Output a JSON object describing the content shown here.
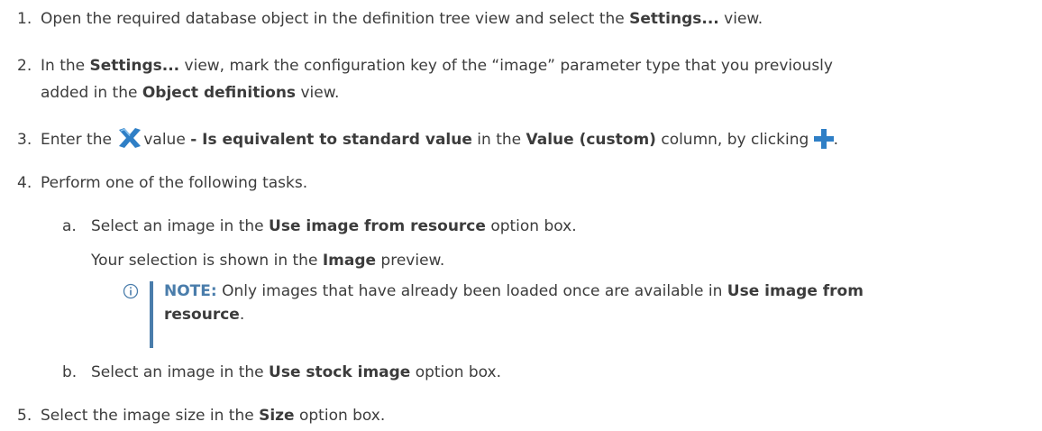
{
  "steps": [
    {
      "num": "1.",
      "t1": "Open the required database object in the definition tree view and select the ",
      "b1": "Settings...",
      "t2": " view."
    },
    {
      "num": "2.",
      "t1": "In the ",
      "b1": "Settings...",
      "t2": " view, mark the configuration key of the “image” parameter type that you previously",
      "line2a": "added in the ",
      "line2b": "Object definitions",
      "line2c": " view."
    },
    {
      "num": "3.",
      "t1": "Enter the ",
      "icon1": "x-icon",
      "t2": "value ",
      "b1": "- Is equivalent to standard value",
      "t3": " in the ",
      "b2": "Value (custom)",
      "t4": " column, by clicking ",
      "icon2": "plus-icon",
      "t5": "."
    },
    {
      "num": "4.",
      "t1": "Perform one of the following tasks."
    },
    {
      "num": "5.",
      "t1": "Select the image size in the ",
      "b1": "Size",
      "t2": " option box."
    }
  ],
  "substeps": [
    {
      "letter": "a.",
      "t1": "Select an image in the ",
      "b1": "Use image from resource",
      "t2": " option box.",
      "para_t1": "Your selection is shown in the ",
      "para_b1": "Image",
      "para_t2": " preview."
    },
    {
      "letter": "b.",
      "t1": "Select an image in the ",
      "b1": "Use stock image",
      "t2": " option box."
    }
  ],
  "note": {
    "icon": "info-icon",
    "label": "NOTE:",
    "t1": " Only images that have already been loaded once are available in ",
    "b1": "Use image from",
    "b2": "resource",
    "t2": "."
  },
  "colors": {
    "accent": "#4a7dab",
    "x_icon": "#2f7fc6",
    "plus_icon": "#2f7fc6",
    "text": "#3c3c3c"
  }
}
